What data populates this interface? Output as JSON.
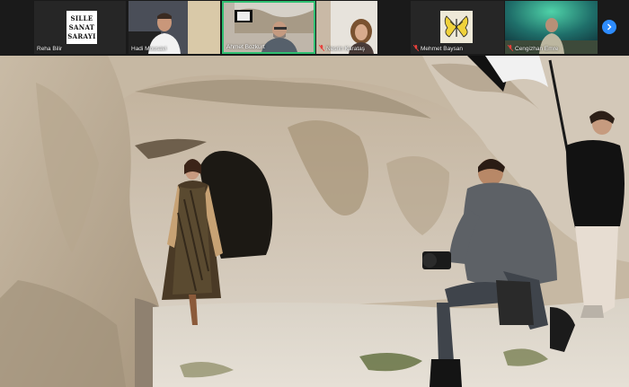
{
  "meeting": {
    "participants": [
      {
        "name": "Reha Bilir",
        "muted": false,
        "kind": "logo",
        "logo_lines": [
          "SILLE",
          "SANAT",
          "SARAYI"
        ]
      },
      {
        "name": "Hadi Mousavi",
        "muted": false,
        "kind": "video"
      },
      {
        "name": "Ahmet Bozkurt",
        "muted": false,
        "kind": "video",
        "active_speaker": true
      },
      {
        "name": "Nesrin Karataş",
        "muted": true,
        "kind": "video"
      },
      {
        "name": "Mehmet Baysan",
        "muted": true,
        "kind": "image",
        "icon": "butterfly"
      },
      {
        "name": "Cengizhan Emre",
        "muted": true,
        "kind": "video"
      }
    ],
    "next_page_icon": "chevron-right-icon",
    "colors": {
      "active_speaker_border": "#2fbf71",
      "muted_mic": "#e8403b",
      "next_button": "#2d8cff"
    }
  },
  "main_video": {
    "scene": "photoshoot-in-cave"
  }
}
